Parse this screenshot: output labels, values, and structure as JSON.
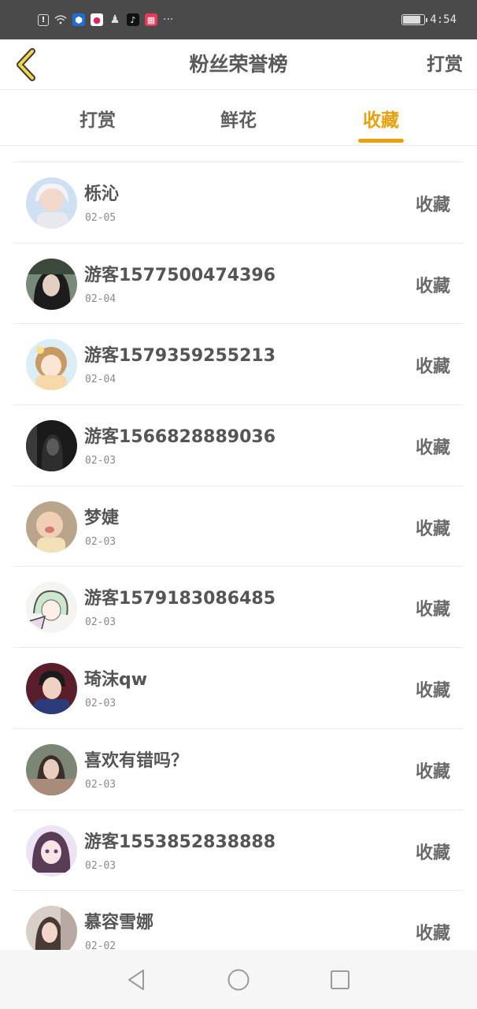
{
  "status_bar": {
    "icons": [
      "alert-icon",
      "wifi-icon",
      "shield-app-icon",
      "video-app-icon",
      "qq-icon",
      "tiktok-icon",
      "calendar-app-icon",
      "more-icon"
    ],
    "more": "···",
    "time": "4:54"
  },
  "header": {
    "title": "粉丝荣誉榜",
    "right_action": "打赏"
  },
  "tabs": [
    {
      "label": "打赏",
      "active": false
    },
    {
      "label": "鲜花",
      "active": false
    },
    {
      "label": "收藏",
      "active": true
    }
  ],
  "colors": {
    "accent": "#e8a00d",
    "text": "#555555",
    "divider": "#ececec"
  },
  "rows": [
    {
      "name": "栎沁",
      "date": "02-05",
      "action": "收藏"
    },
    {
      "name": "游客1577500474396",
      "date": "02-04",
      "action": "收藏"
    },
    {
      "name": "游客1579359255213",
      "date": "02-04",
      "action": "收藏"
    },
    {
      "name": "游客1566828889036",
      "date": "02-03",
      "action": "收藏"
    },
    {
      "name": "梦婕",
      "date": "02-03",
      "action": "收藏"
    },
    {
      "name": "游客1579183086485",
      "date": "02-03",
      "action": "收藏"
    },
    {
      "name": "琦沫qw",
      "date": "02-03",
      "action": "收藏"
    },
    {
      "name": "喜欢有错吗？",
      "date": "02-03",
      "action": "收藏"
    },
    {
      "name": "游客1553852838888",
      "date": "02-03",
      "action": "收藏"
    },
    {
      "name": "慕容雪娜",
      "date": "02-02",
      "action": "收藏"
    }
  ]
}
